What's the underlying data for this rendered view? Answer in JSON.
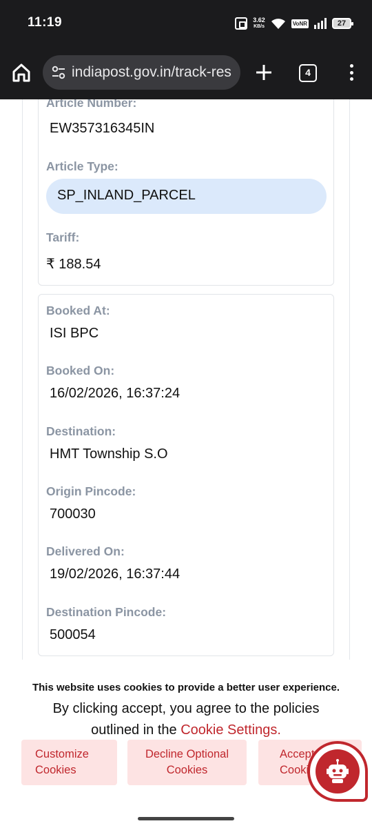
{
  "status_bar": {
    "time": "11:19",
    "net_speed_value": "3.62",
    "net_speed_unit": "KB/s",
    "vonr": "VoNR",
    "battery": "27"
  },
  "browser": {
    "url": "indiapost.gov.in/track-res",
    "tab_count": "4"
  },
  "article_card": {
    "article_number_label": "Article Number:",
    "article_number": "EW357316345IN",
    "article_type_label": "Article Type:",
    "article_type": "SP_INLAND_PARCEL",
    "tariff_label": "Tariff:",
    "tariff": "₹ 188.54"
  },
  "booking_card": {
    "booked_at_label": "Booked At:",
    "booked_at": "ISI BPC",
    "booked_on_label": "Booked On:",
    "booked_on": "16/02/2026, 16:37:24",
    "destination_label": "Destination:",
    "destination": "HMT Township S.O",
    "origin_pincode_label": "Origin Pincode:",
    "origin_pincode": "700030",
    "delivered_on_label": "Delivered On:",
    "delivered_on": "19/02/2026, 16:37:44",
    "destination_pincode_label": "Destination Pincode:",
    "destination_pincode": "500054"
  },
  "cookie_banner": {
    "title": "This website uses cookies to provide a better user experience.",
    "text": "By clicking accept, you agree to the policies outlined in the",
    "link": "Cookie Settings.",
    "customize_line1": "Customize",
    "customize_line2": "Cookies",
    "decline_line1": "Decline Optional",
    "decline_line2": "Cookies",
    "accept_line1": "Accept",
    "accept_line2": "Cookies"
  },
  "colors": {
    "accent": "#c0272d",
    "pill": "#dbe9fb",
    "label": "#8b95a3",
    "toolbar": "#1b1b1d"
  },
  "icons": [
    "home-icon",
    "site-settings-icon",
    "plus-icon",
    "more-vert-icon",
    "chatbot-icon",
    "wifi-icon",
    "signal-icon",
    "nfc-icon",
    "battery-icon"
  ]
}
